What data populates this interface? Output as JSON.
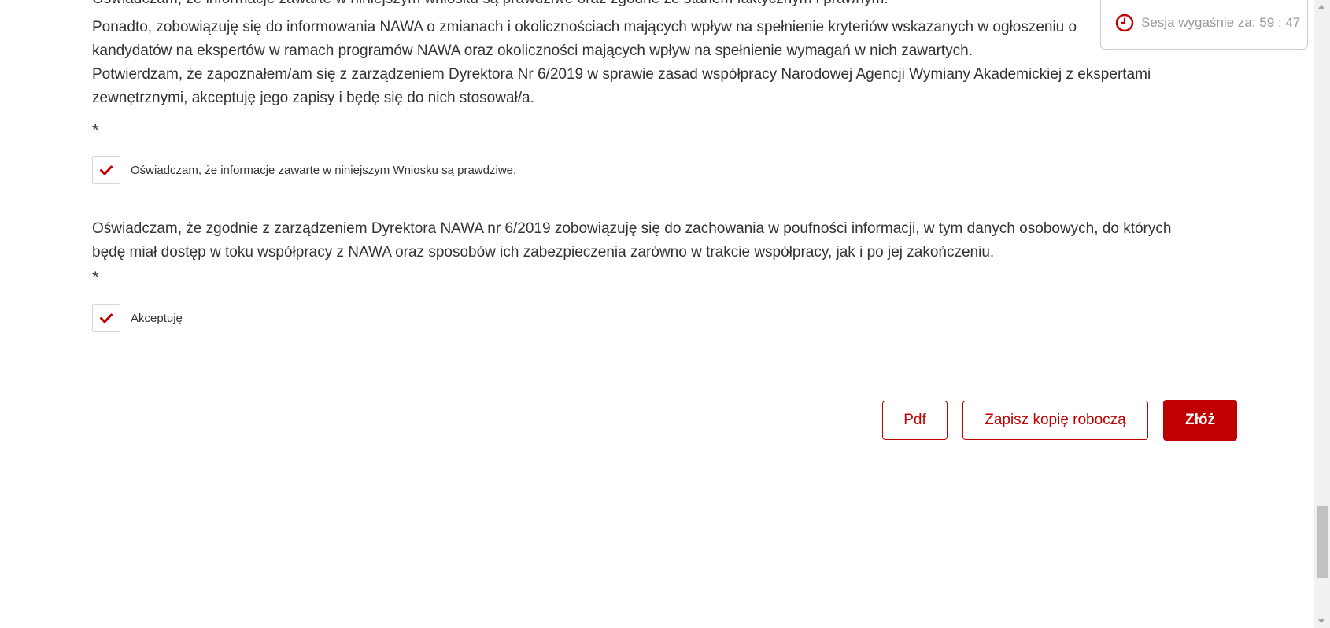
{
  "document": {
    "partial_top_text": "Oświadczam, że informacje zawarte w niniejszym wniosku są prawdziwe oraz zgodne ze stanem faktycznym i prawnym.",
    "paragraph1_line1": "Ponadto, zobowiązuję się do informowania NAWA o zmianach i okolicznościach mających wpływ na spełnienie kryteriów wskazanych w ogłoszeniu o",
    "paragraph1_line2": "kandydatów na ekspertów w ramach programów NAWA oraz okoliczności mających wpływ na spełnienie wymagań w nich zawartych.",
    "paragraph1_line3": "Potwierdzam, że zapoznałem/am się z zarządzeniem Dyrektora Nr 6/2019 w sprawie zasad współpracy Narodowej Agencji Wymiany Akademickiej z ekspertami",
    "paragraph1_line4": "zewnętrznymi, akceptuję jego zapisy i będę się do nich stosował/a.",
    "required_mark_1": "*",
    "checkbox1_label": "Oświadczam, że informacje zawarte w niniejszym Wniosku są prawdziwe.",
    "paragraph2_line1": "Oświadczam, że zgodnie z zarządzeniem Dyrektora NAWA nr 6/2019 zobowiązuję się do zachowania w poufności informacji, w tym danych osobowych, do których",
    "paragraph2_line2": "będę miał dostęp w toku współpracy z NAWA oraz sposobów ich zabezpieczenia zarówno w trakcie współpracy, jak i po jej zakończeniu.",
    "required_mark_2": "*",
    "checkbox2_label": "Akceptuję"
  },
  "checkboxes": {
    "checkbox1_checked": true,
    "checkbox2_checked": true
  },
  "buttons": {
    "pdf_label": "Pdf",
    "save_draft_label": "Zapisz kopię roboczą",
    "submit_label": "Złóż"
  },
  "session": {
    "text": "Sesja wygaśnie za: 59 : 47",
    "icon": "clock-icon"
  },
  "colors": {
    "accent": "#c00000",
    "text": "#333333",
    "session_text": "#9a9a9a"
  }
}
